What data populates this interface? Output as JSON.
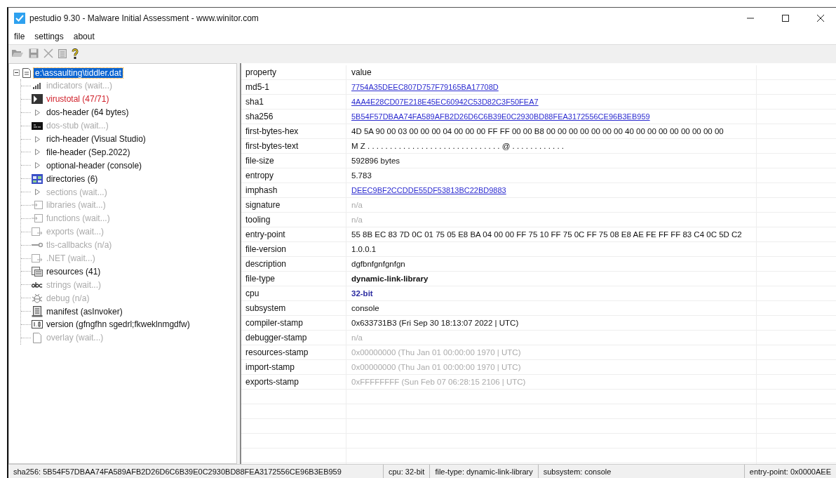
{
  "window": {
    "title": "pestudio 9.30 - Malware Initial Assessment - www.winitor.com"
  },
  "menu": [
    "file",
    "settings",
    "about"
  ],
  "tree": {
    "label": "e:\\assaulting\\tiddler.dat",
    "selected": true,
    "expanded": true,
    "children": [
      {
        "label": "indicators (wait...)",
        "kind": "bars",
        "disabled": true,
        "alert": false
      },
      {
        "label": "virustotal (47/71)",
        "kind": "virustotal",
        "disabled": false,
        "alert": true
      },
      {
        "label": "dos-header (64 bytes)",
        "kind": "triangle",
        "disabled": false,
        "alert": false
      },
      {
        "label": "dos-stub (wait...)",
        "kind": "console",
        "disabled": true,
        "alert": false
      },
      {
        "label": "rich-header (Visual Studio)",
        "kind": "triangle",
        "disabled": false,
        "alert": false
      },
      {
        "label": "file-header (Sep.2022)",
        "kind": "triangle",
        "disabled": false,
        "alert": false
      },
      {
        "label": "optional-header (console)",
        "kind": "triangle",
        "disabled": false,
        "alert": false
      },
      {
        "label": "directories (6)",
        "kind": "grid",
        "disabled": false,
        "alert": false
      },
      {
        "label": "sections (wait...)",
        "kind": "triangle",
        "disabled": true,
        "alert": false
      },
      {
        "label": "libraries (wait...)",
        "kind": "import",
        "disabled": true,
        "alert": false
      },
      {
        "label": "functions (wait...)",
        "kind": "import",
        "disabled": true,
        "alert": false
      },
      {
        "label": "exports (wait...)",
        "kind": "export",
        "disabled": true,
        "alert": false
      },
      {
        "label": "tls-callbacks (n/a)",
        "kind": "key",
        "disabled": true,
        "alert": false
      },
      {
        "label": ".NET (wait...)",
        "kind": "export",
        "disabled": true,
        "alert": false
      },
      {
        "label": "resources (41)",
        "kind": "resources",
        "disabled": false,
        "alert": false
      },
      {
        "label": "strings (wait...)",
        "kind": "abc",
        "disabled": true,
        "alert": false
      },
      {
        "label": "debug (n/a)",
        "kind": "bug",
        "disabled": true,
        "alert": false
      },
      {
        "label": "manifest (asInvoker)",
        "kind": "manifest",
        "disabled": false,
        "alert": false
      },
      {
        "label": "version (gfngfhn sgedrl;fkweklnmgdfw)",
        "kind": "version",
        "disabled": false,
        "alert": false
      },
      {
        "label": "overlay (wait...)",
        "kind": "page",
        "disabled": true,
        "alert": false
      }
    ]
  },
  "table": {
    "columns": [
      "property",
      "value"
    ],
    "rows": [
      {
        "property": "md5-1",
        "value": "7754A35DEEC807D757F79165BA17708D",
        "kind": "link"
      },
      {
        "property": "sha1",
        "value": "4AA4E28CD07E218E45EC60942C53D82C3F50FEA7",
        "kind": "link"
      },
      {
        "property": "sha256",
        "value": "5B54F57DBAA74FA589AFB2D26D6C6B39E0C2930BD88FEA3172556CE96B3EB959",
        "kind": "link"
      },
      {
        "property": "first-bytes-hex",
        "value": "4D 5A 90 00 03 00 00 00 04 00 00 00 FF FF 00 00 B8 00 00 00 00 00 00 00 40 00 00 00 00 00 00 00 00",
        "kind": "plain"
      },
      {
        "property": "first-bytes-text",
        "value": "M Z . . . . . . . . . . . . . . . . . . . . . . . . . . . . . . @ . . . . . . . . . . . .",
        "kind": "plain"
      },
      {
        "property": "file-size",
        "value": "592896 bytes",
        "kind": "plain"
      },
      {
        "property": "entropy",
        "value": "5.783",
        "kind": "plain"
      },
      {
        "property": "imphash",
        "value": "DEEC9BF2CCDDE55DF53813BC22BD9883",
        "kind": "link"
      },
      {
        "property": "signature",
        "value": "n/a",
        "kind": "muted"
      },
      {
        "property": "tooling",
        "value": "n/a",
        "kind": "muted"
      },
      {
        "property": "entry-point",
        "value": "55 8B EC 83 7D 0C 01 75 05 E8 BA 04 00 00 FF 75 10 FF 75 0C FF 75 08 E8 AE FE FF FF 83 C4 0C 5D C2",
        "kind": "plain"
      },
      {
        "property": "file-version",
        "value": "1.0.0.1",
        "kind": "plain"
      },
      {
        "property": "description",
        "value": "dgfbnfgnfgnfgn",
        "kind": "plain"
      },
      {
        "property": "file-type",
        "value": "dynamic-link-library",
        "kind": "bold"
      },
      {
        "property": "cpu",
        "value": "32-bit",
        "kind": "accent"
      },
      {
        "property": "subsystem",
        "value": "console",
        "kind": "plain"
      },
      {
        "property": "compiler-stamp",
        "value": "0x633731B3 (Fri Sep 30 18:13:07 2022 | UTC)",
        "kind": "plain"
      },
      {
        "property": "debugger-stamp",
        "value": "n/a",
        "kind": "muted"
      },
      {
        "property": "resources-stamp",
        "value": "0x00000000 (Thu Jan 01 00:00:00 1970 | UTC)",
        "kind": "muted"
      },
      {
        "property": "import-stamp",
        "value": "0x00000000 (Thu Jan 01 00:00:00 1970 | UTC)",
        "kind": "muted"
      },
      {
        "property": "exports-stamp",
        "value": "0xFFFFFFFF (Sun Feb 07 06:28:15 2106 | UTC)",
        "kind": "muted"
      }
    ]
  },
  "status_bar": [
    "sha256: 5B54F57DBAA74FA589AFB2D26D6C6B39E0C2930BD88FEA3172556CE96B3EB959",
    "cpu: 32-bit",
    "file-type: dynamic-link-library",
    "subsystem: console",
    "entry-point: 0x0000AEE"
  ]
}
